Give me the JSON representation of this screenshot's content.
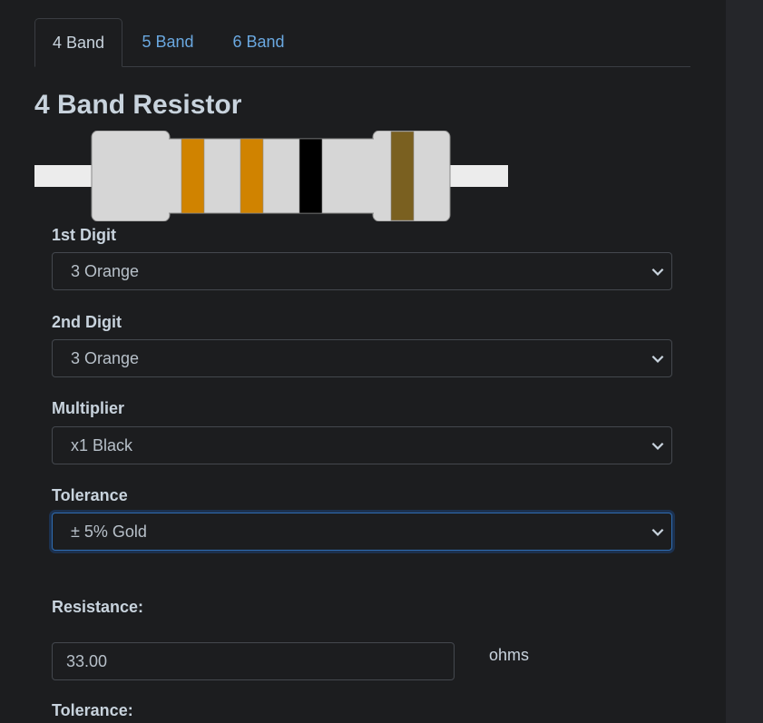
{
  "tabs": [
    {
      "label": "4 Band",
      "active": true
    },
    {
      "label": "5 Band",
      "active": false
    },
    {
      "label": "6 Band",
      "active": false
    }
  ],
  "title": "4 Band Resistor",
  "resistor": {
    "bands": [
      {
        "name": "1st Digit",
        "color": "#d08300"
      },
      {
        "name": "2nd Digit",
        "color": "#d08300"
      },
      {
        "name": "Multiplier",
        "color": "#000000"
      },
      {
        "name": "Tolerance",
        "color": "#7a6020"
      }
    ],
    "body_color": "#d6d6d6",
    "lead_color": "#ececec"
  },
  "fields": {
    "digit1": {
      "label": "1st Digit",
      "value": "3 Orange"
    },
    "digit2": {
      "label": "2nd Digit",
      "value": "3 Orange"
    },
    "multiplier": {
      "label": "Multiplier",
      "value": "x1 Black"
    },
    "tolerance": {
      "label": "Tolerance",
      "value": "± 5% Gold"
    }
  },
  "results": {
    "resistance_label": "Resistance:",
    "resistance_value": "33.00",
    "resistance_unit": "ohms",
    "tolerance_label": "Tolerance:"
  },
  "icons": {
    "dropdown": "chevron-down-icon"
  }
}
